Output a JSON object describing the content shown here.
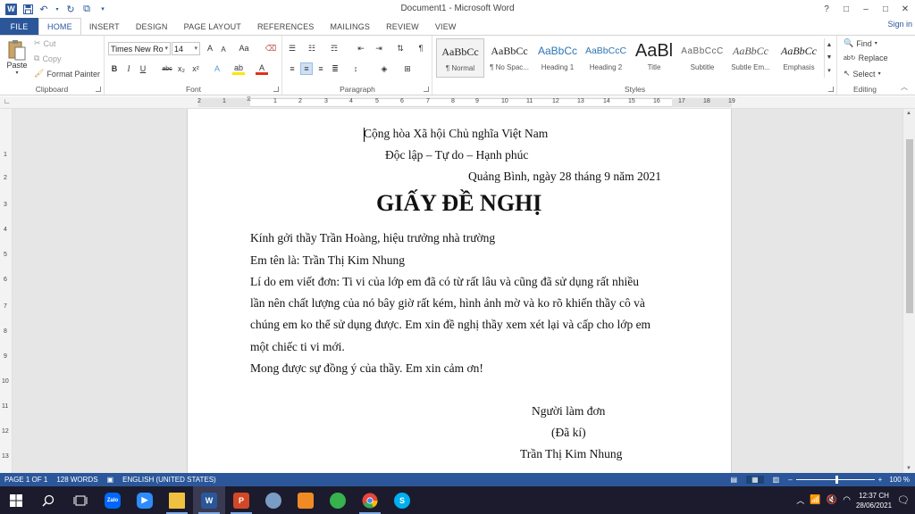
{
  "window": {
    "title": "Document1 - Microsoft Word",
    "controls": [
      "?",
      "□",
      "–",
      "□",
      "✕"
    ]
  },
  "tabs": [
    "FILE",
    "HOME",
    "INSERT",
    "DESIGN",
    "PAGE LAYOUT",
    "REFERENCES",
    "MAILINGS",
    "REVIEW",
    "VIEW"
  ],
  "active_tab": "HOME",
  "signin": "Sign in",
  "ribbon": {
    "clipboard": {
      "paste": "Paste",
      "cut": "Cut",
      "copy": "Copy",
      "format_painter": "Format Painter",
      "label": "Clipboard"
    },
    "font": {
      "name": "Times New Ro",
      "size": "14",
      "label": "Font",
      "grow": "A",
      "shrink": "A",
      "case": "Aa",
      "bold": "B",
      "italic": "I",
      "underline": "U",
      "strike": "abc",
      "sub": "x₂",
      "sup": "x²",
      "effects": "A",
      "highlight": "ab",
      "color": "A",
      "font_color": "#e0301e",
      "highlight_color": "#ffe600"
    },
    "paragraph": {
      "label": "Paragraph",
      "pilcrow": "¶"
    },
    "styles": {
      "label": "Styles",
      "items": [
        {
          "preview": "AaBbCc",
          "name": "¶ Normal"
        },
        {
          "preview": "AaBbCc",
          "name": "¶ No Spac..."
        },
        {
          "preview": "AaBbCc",
          "name": "Heading 1"
        },
        {
          "preview": "AaBbCcC",
          "name": "Heading 2"
        },
        {
          "preview": "AaBl",
          "name": "Title"
        },
        {
          "preview": "AaBbCcC",
          "name": "Subtitle"
        },
        {
          "preview": "AaBbCc",
          "name": "Subtle Em..."
        },
        {
          "preview": "AaBbCc",
          "name": "Emphasis"
        }
      ]
    },
    "editing": {
      "find": "Find",
      "replace": "Replace",
      "select": "Select",
      "label": "Editing"
    }
  },
  "ruler": {
    "numbers": [
      "2",
      "1",
      "1",
      "2",
      "3",
      "4",
      "5",
      "6",
      "7",
      "8",
      "9",
      "10",
      "11",
      "12",
      "13",
      "14",
      "15",
      "16",
      "17",
      "18",
      "19"
    ]
  },
  "vruler": {
    "numbers": [
      "1",
      "2",
      "3",
      "4",
      "5",
      "6",
      "7",
      "8",
      "9",
      "10",
      "11",
      "12",
      "13"
    ]
  },
  "document": {
    "motto1": "Cộng hòa Xã hội Chủ nghĩa Việt Nam",
    "motto2": "Độc lập – Tự do – Hạnh phúc",
    "date": "Quảng Bình, ngày 28 tháng 9 năm 2021",
    "heading": "GIẤY ĐỀ NGHỊ",
    "greeting": "Kính gởi thầy Trần Hoàng, hiệu trưởng nhà trường",
    "name": "Em tên là: Trần Thị Kim Nhung",
    "reason1": "Lí do em viết đơn: Ti vi của lớp em đã có từ rất lâu và cũng đã sử dụng rất nhiều",
    "reason2": "lần nên chất lượng của nó bây giờ rất kém, hình ảnh mờ và ko rõ khiến thầy cô và",
    "reason3": "chúng em ko thể sử dụng được. Em xin đề nghị thầy xem xét lại và cấp cho lớp em",
    "reason4": "một chiếc ti vi mới.",
    "closing": "Mong được sự đồng ý của thầy. Em xin cảm ơn!",
    "signer_label": "Người làm đơn",
    "signed": "(Đã kí)",
    "signer_name": "Trần Thị Kim Nhung"
  },
  "status": {
    "page": "PAGE 1 OF 1",
    "words": "128 WORDS",
    "language": "ENGLISH (UNITED STATES)",
    "zoom": "100 %"
  },
  "taskbar": {
    "apps": [
      {
        "icon": "zalo-icon",
        "label": "Zalo",
        "color": "#0068ff"
      },
      {
        "icon": "zoom-icon",
        "label": "Z",
        "color": "#2d8cff"
      },
      {
        "icon": "file-explorer-icon",
        "label": "",
        "color": "#f0c040"
      },
      {
        "icon": "word-icon",
        "label": "W",
        "color": "#2b579a"
      },
      {
        "icon": "powerpoint-icon",
        "label": "P",
        "color": "#d24726"
      },
      {
        "icon": "paint-icon",
        "label": "",
        "color": "#7a9cc4"
      },
      {
        "icon": "app-orange-icon",
        "label": "",
        "color": "#f08a24"
      },
      {
        "icon": "app-round-icon",
        "label": "",
        "color": "#37b24d"
      },
      {
        "icon": "chrome-icon",
        "label": "",
        "color": "#e8453c"
      },
      {
        "icon": "skype-icon",
        "label": "S",
        "color": "#00aff0"
      }
    ],
    "time": "12:37 CH",
    "date": "28/06/2021"
  }
}
